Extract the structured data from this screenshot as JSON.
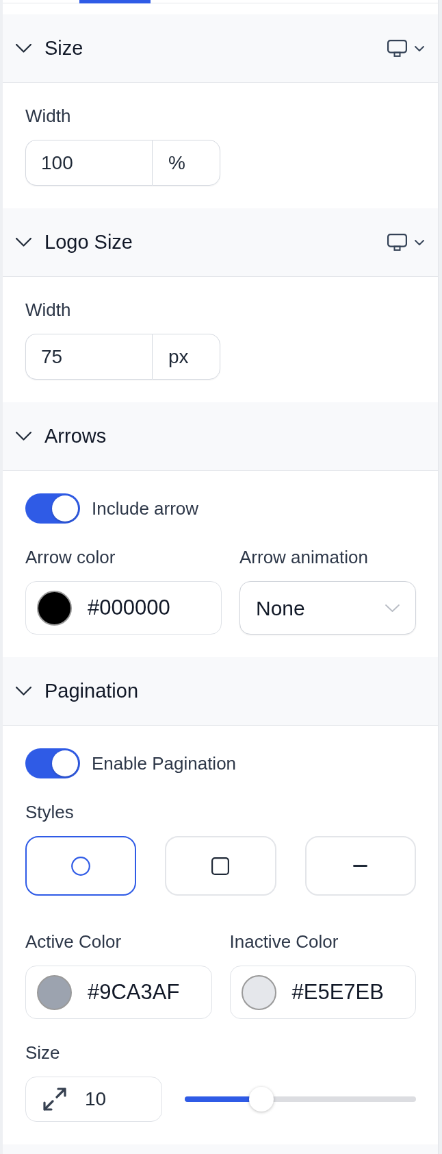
{
  "sections": [
    {
      "title": "Size",
      "expanded": true,
      "device_menu": true,
      "fields": [
        {
          "kind": "unit_input",
          "label": "Width",
          "value": "100",
          "unit": "%"
        }
      ]
    },
    {
      "title": "Logo Size",
      "expanded": true,
      "device_menu": true,
      "fields": [
        {
          "kind": "unit_input",
          "label": "Width",
          "value": "75",
          "unit": "px"
        }
      ]
    },
    {
      "title": "Arrows",
      "expanded": true,
      "fields": [
        {
          "kind": "toggle",
          "label": "Include arrow",
          "on": true
        },
        {
          "kind": "row",
          "items": [
            {
              "kind": "color",
              "label": "Arrow color",
              "value": "#000000",
              "color": "#000000"
            },
            {
              "kind": "select",
              "label": "Arrow animation",
              "value": "None"
            }
          ]
        }
      ]
    },
    {
      "title": "Pagination",
      "expanded": true,
      "fields": [
        {
          "kind": "toggle",
          "label": "Enable Pagination",
          "on": true
        },
        {
          "kind": "style_picker",
          "label": "Styles",
          "options": [
            {
              "kind": "circle",
              "selected": true
            },
            {
              "kind": "square",
              "selected": false
            },
            {
              "kind": "dash",
              "selected": false
            }
          ]
        },
        {
          "kind": "row",
          "items": [
            {
              "kind": "color",
              "label": "Active Color",
              "value": "#9CA3AF",
              "color": "#9ca3af"
            },
            {
              "kind": "color",
              "label": "Inactive Color",
              "value": "#E5E7EB",
              "color": "#e5e7eb"
            }
          ]
        },
        {
          "kind": "size_slider",
          "label": "Size",
          "value": "10",
          "level": 0.33
        }
      ]
    }
  ]
}
